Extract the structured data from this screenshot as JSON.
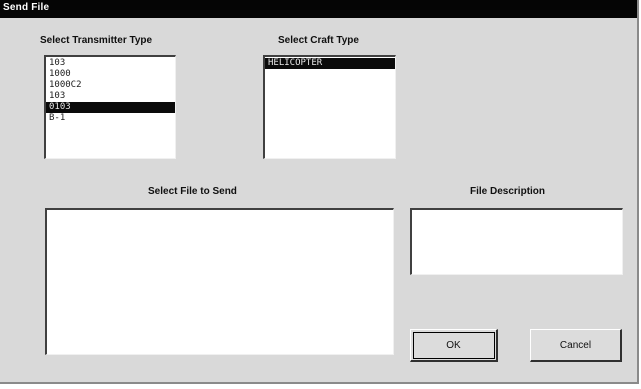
{
  "window": {
    "title": "Send File"
  },
  "transmitter": {
    "label": "Select Transmitter Type",
    "items": [
      "103",
      "1000",
      "1000C2",
      "103",
      "0103",
      "B-1"
    ],
    "selected_index": 4
  },
  "craft": {
    "label": "Select Craft Type",
    "items": [
      "HELICOPTER"
    ],
    "selected_index": 0
  },
  "file": {
    "label": "Select File to Send",
    "items": []
  },
  "description": {
    "label": "File Description",
    "value": ""
  },
  "buttons": {
    "ok": "OK",
    "cancel": "Cancel"
  }
}
